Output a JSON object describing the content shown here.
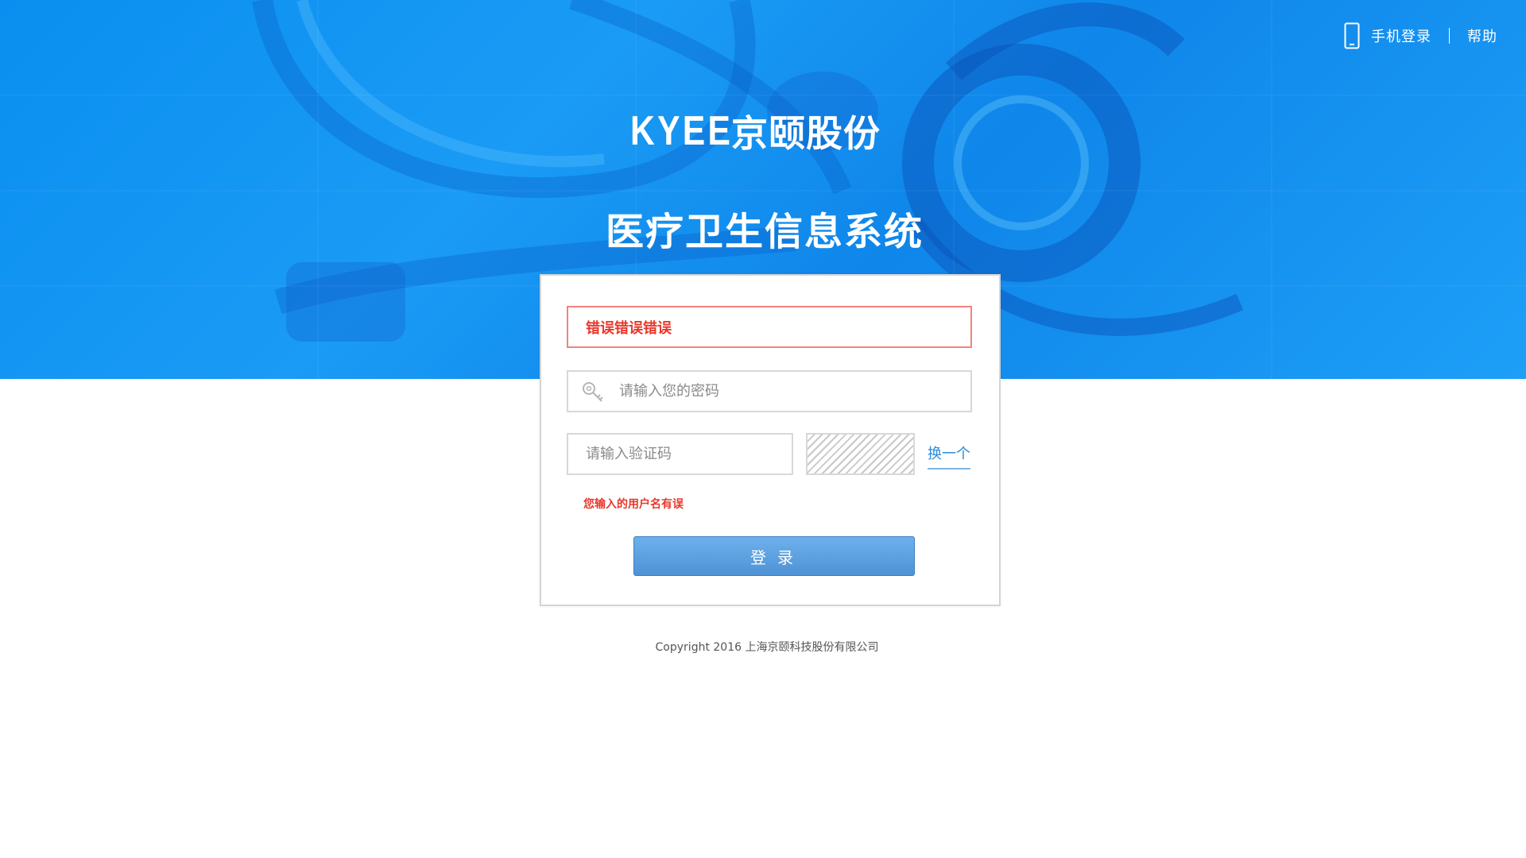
{
  "topnav": {
    "phone_icon": "mobile-phone-icon",
    "mobile_login": "手机登录",
    "separator": "|",
    "help": "帮助"
  },
  "logo": {
    "brand_en": "KYEE",
    "brand_cn": "京颐股份"
  },
  "system_title": "医疗卫生信息系统",
  "login_form": {
    "username_value": "错误错误错误",
    "password_placeholder": "请输入您的密码",
    "password_icon": "key-icon",
    "captcha_placeholder": "请输入验证码",
    "refresh_captcha": "换一个",
    "error_message": "您输入的用户名有误",
    "submit_label": "登录"
  },
  "footer": {
    "copyright": "Copyright 2016 上海京颐科技股份有限公司"
  },
  "colors": {
    "hero_blue": "#0a8ff0",
    "error_red": "#e8382c",
    "link_blue": "#2e8ad8",
    "button_blue": "#5a9ee0"
  }
}
